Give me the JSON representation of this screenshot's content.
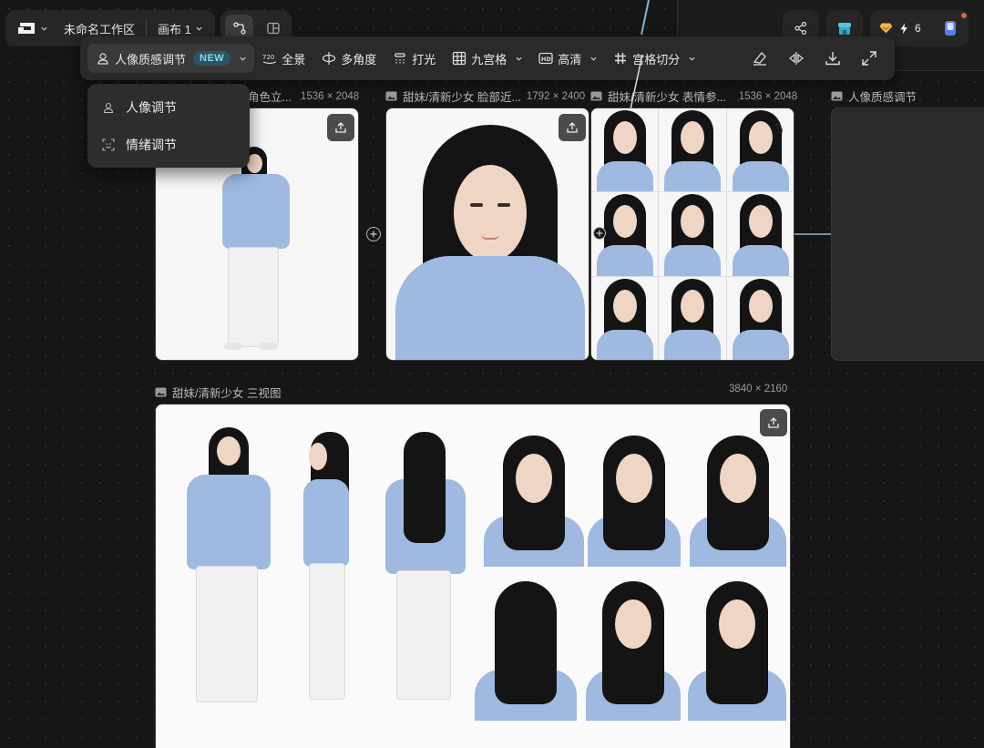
{
  "app": {
    "workspace": "未命名工作区",
    "canvas": "画布 1"
  },
  "toolbar": {
    "portrait": "人像质感调节",
    "badge": "NEW",
    "items": [
      "全景",
      "多角度",
      "打光",
      "九宫格",
      "高清",
      "宫格切分"
    ]
  },
  "credits": {
    "count": "6"
  },
  "dropdown": {
    "items": [
      "人像调节",
      "情绪调节"
    ]
  },
  "cards": [
    {
      "title": "角色立...",
      "dims": "1536 × 2048"
    },
    {
      "title": "甜妹/清新少女 脸部近...",
      "dims": "1792 × 2400"
    },
    {
      "title": "甜妹/清新少女 表情参...",
      "dims": "1536 × 2048"
    },
    {
      "title": "人像质感调节",
      "dims": ""
    },
    {
      "title": "甜妹/清新少女 三视图",
      "dims": "3840 × 2160"
    }
  ],
  "colors": {
    "accent_new": "#8fd6e8",
    "sweater": "#9fb9e0",
    "background": "#161616"
  }
}
